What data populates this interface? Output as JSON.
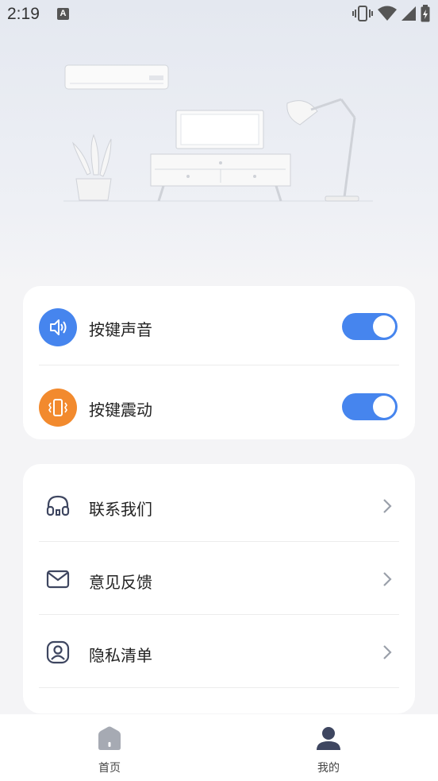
{
  "status_bar": {
    "time": "2:19",
    "notification_letter": "A",
    "icons": [
      "vibrate-icon",
      "wifi-icon",
      "signal-icon",
      "battery-icon"
    ]
  },
  "settings": {
    "key_sound": {
      "label": "按键声音",
      "icon": "speaker-icon",
      "icon_color": "#4685ee",
      "enabled": true
    },
    "key_vibration": {
      "label": "按键震动",
      "icon": "phone-vibrate-icon",
      "icon_color": "#f28a2e",
      "enabled": true
    }
  },
  "menu": [
    {
      "label": "联系我们",
      "icon": "headset-icon"
    },
    {
      "label": "意见反馈",
      "icon": "mail-icon"
    },
    {
      "label": "隐私清单",
      "icon": "privacy-icon"
    }
  ],
  "tabbar": {
    "home": {
      "label": "首页",
      "icon": "home-icon",
      "active": false
    },
    "mine": {
      "label": "我的",
      "icon": "user-icon",
      "active": true
    }
  },
  "colors": {
    "accent": "#4685ee",
    "orange": "#f28a2e",
    "dark_icon": "#3e4660"
  }
}
